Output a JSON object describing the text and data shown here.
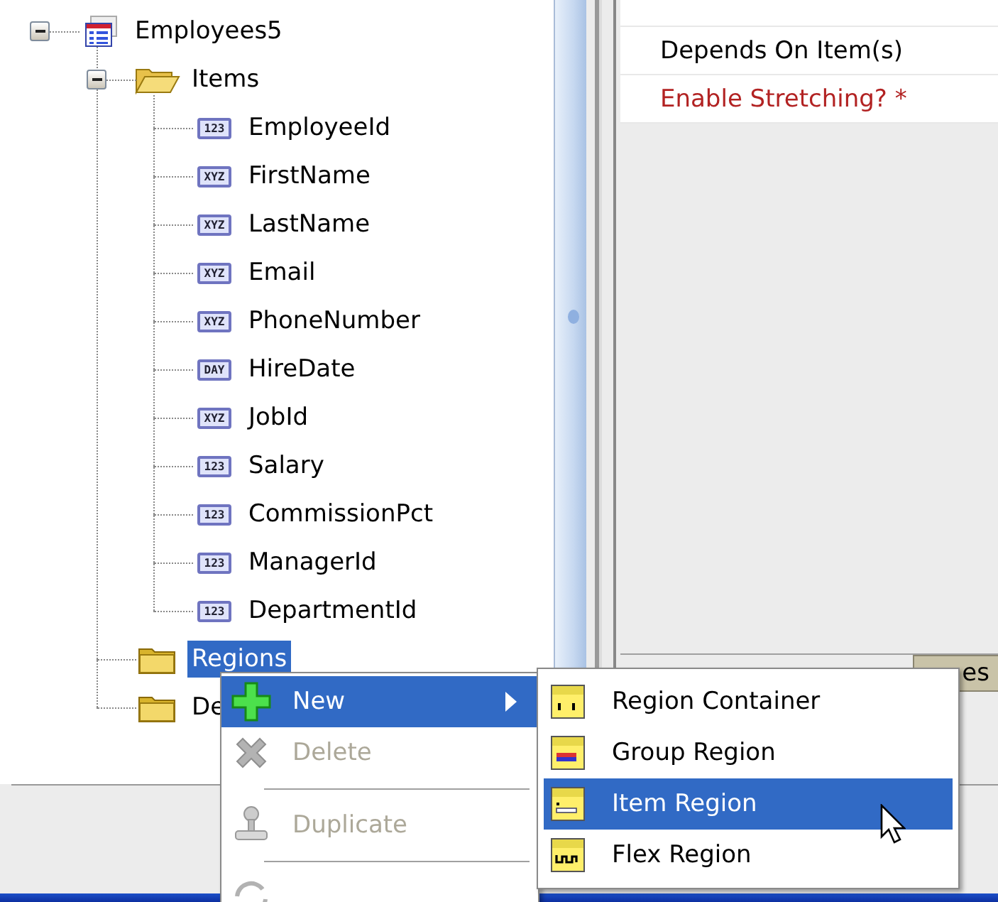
{
  "tree": {
    "label": "Employees5",
    "kind": "table",
    "expanded": true,
    "selected": false,
    "children": [
      {
        "label": "Items",
        "kind": "folder",
        "expanded": true,
        "selected": false,
        "children": [
          {
            "label": "EmployeeId",
            "kind": "badge",
            "badge": "123",
            "selected": false
          },
          {
            "label": "FirstName",
            "kind": "badge",
            "badge": "XYZ",
            "selected": false
          },
          {
            "label": "LastName",
            "kind": "badge",
            "badge": "XYZ",
            "selected": false
          },
          {
            "label": "Email",
            "kind": "badge",
            "badge": "XYZ",
            "selected": false
          },
          {
            "label": "PhoneNumber",
            "kind": "badge",
            "badge": "XYZ",
            "selected": false
          },
          {
            "label": "HireDate",
            "kind": "badge",
            "badge": "DAY",
            "selected": false
          },
          {
            "label": "JobId",
            "kind": "badge",
            "badge": "XYZ",
            "selected": false
          },
          {
            "label": "Salary",
            "kind": "badge",
            "badge": "123",
            "selected": false
          },
          {
            "label": "CommissionPct",
            "kind": "badge",
            "badge": "123",
            "selected": false
          },
          {
            "label": "ManagerId",
            "kind": "badge",
            "badge": "123",
            "selected": false
          },
          {
            "label": "DepartmentId",
            "kind": "badge",
            "badge": "123",
            "selected": false
          }
        ]
      },
      {
        "label": "Regions",
        "kind": "folder",
        "selected": true
      },
      {
        "label": "De",
        "kind": "folder",
        "selected": false
      }
    ]
  },
  "properties": [
    {
      "label": "Depends On Item(s)",
      "required": false
    },
    {
      "label": "Enable Stretching? *",
      "required": true
    }
  ],
  "bottom_tabs": [
    {
      "label": "es"
    }
  ],
  "context_menu": [
    {
      "kind": "item",
      "label": "New",
      "selected": true,
      "disabled": false,
      "submenu": true
    },
    {
      "kind": "item",
      "label": "Delete",
      "selected": false,
      "disabled": true,
      "submenu": false
    },
    {
      "kind": "separator"
    },
    {
      "kind": "item",
      "label": "Duplicate",
      "selected": false,
      "disabled": true,
      "submenu": false
    },
    {
      "kind": "separator"
    },
    {
      "kind": "item",
      "selected": false,
      "disabled": true,
      "submenu": false
    }
  ],
  "submenu": [
    {
      "label": "Region Container",
      "selected": false
    },
    {
      "label": "Group Region",
      "selected": false
    },
    {
      "label": "Item Region",
      "selected": true
    },
    {
      "label": "Flex Region",
      "selected": false
    }
  ]
}
